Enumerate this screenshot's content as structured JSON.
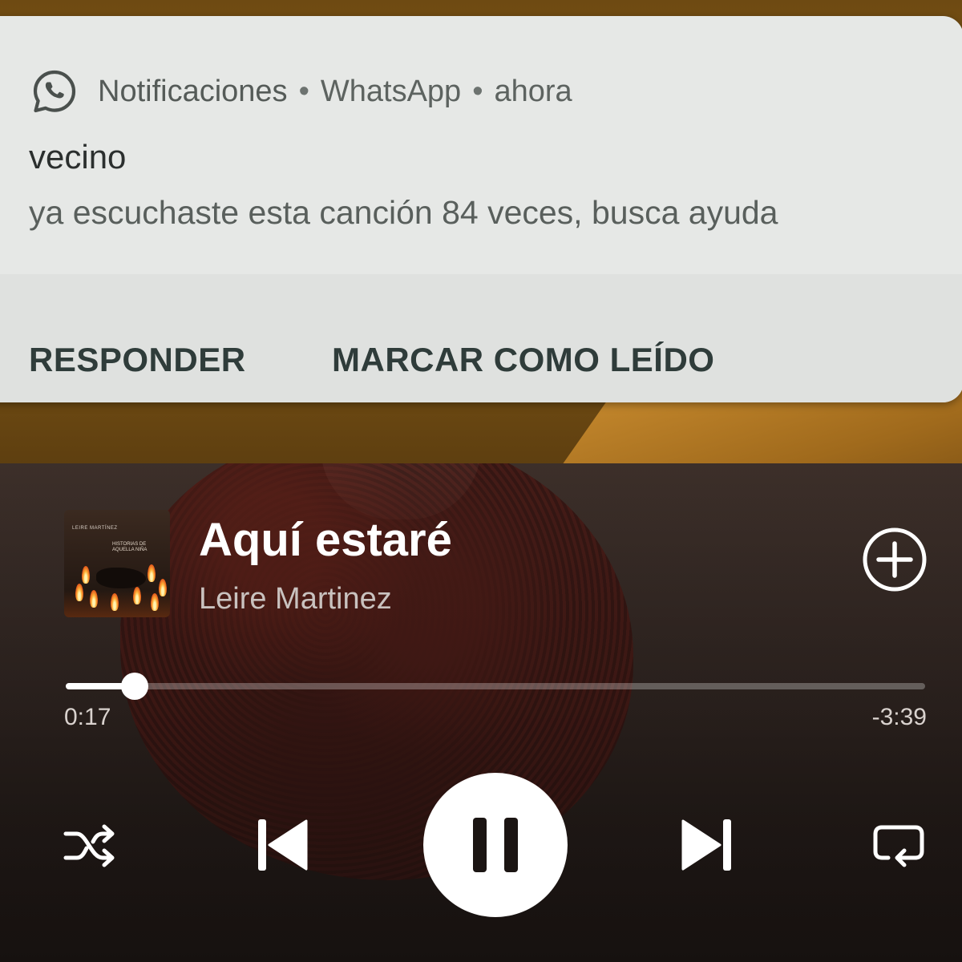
{
  "notification": {
    "app_label": "Notificaciones",
    "separator": "•",
    "app_name": "WhatsApp",
    "time": "ahora",
    "sender": "vecino",
    "message": "ya escuchaste esta canción 84 veces, busca ayuda",
    "icon": "whatsapp-icon",
    "actions": {
      "reply": "RESPONDER",
      "mark_read": "MARCAR COMO LEÍDO"
    }
  },
  "player": {
    "track_title": "Aquí estaré",
    "artist": "Leire Martinez",
    "album_art": {
      "artist_text": "LEIRE MARTÍNEZ",
      "album_text": "HISTORIAS DE AQUELLA NIÑA"
    },
    "elapsed": "0:17",
    "remaining": "-3:39",
    "progress_fraction": 0.08,
    "icons": {
      "add": "add-circle-icon",
      "shuffle": "shuffle-icon",
      "previous": "skip-previous-icon",
      "play_pause": "pause-icon",
      "next": "skip-next-icon",
      "repeat": "repeat-icon"
    },
    "colors": {
      "accent": "#ffffff",
      "track": "#6b6562"
    }
  }
}
